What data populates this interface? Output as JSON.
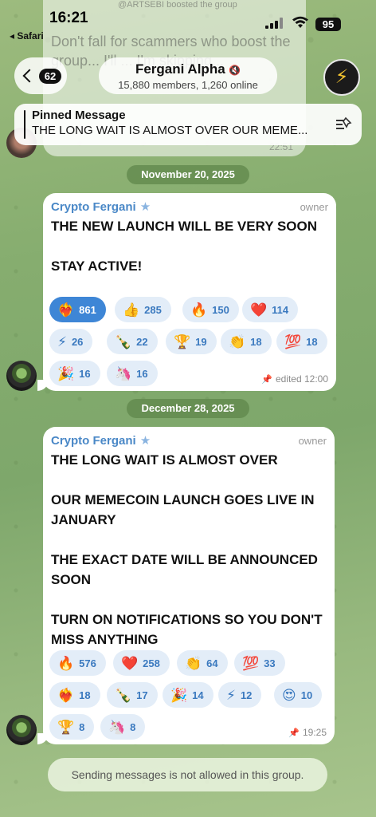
{
  "status_bar": {
    "time": "16:21",
    "back_app": "◂ Safari",
    "battery": "95"
  },
  "previous_message": {
    "top_text": "@ARTSEBI boosted the group",
    "text": "Don't fall for scammers who boost the group... I'll ... I'm skipping...",
    "time": "22:51"
  },
  "header": {
    "unread_count": "62",
    "title": "Fergani Alpha",
    "subtitle": "15,880 members, 1,260 online",
    "avatar_glyph": "⚡"
  },
  "pinned": {
    "label": "Pinned Message",
    "text": "THE LONG WAIT IS ALMOST OVER OUR MEME..."
  },
  "dates": [
    "November 20, 2025",
    "December 28, 2025"
  ],
  "messages": [
    {
      "sender": "Crypto Fergani",
      "role": "owner",
      "text": "THE NEW LAUNCH WILL BE VERY SOON\n\nSTAY ACTIVE!",
      "meta": "edited 12:00",
      "reactions": [
        {
          "emoji": "❤️‍🔥",
          "count": "861",
          "chosen": true
        },
        {
          "emoji": "👍",
          "count": "285"
        },
        {
          "emoji": "🔥",
          "count": "150"
        },
        {
          "emoji": "❤️",
          "count": "114"
        },
        {
          "emoji": "⚡",
          "count": "26"
        },
        {
          "emoji": "🍾",
          "count": "22"
        },
        {
          "emoji": "🏆",
          "count": "19"
        },
        {
          "emoji": "👏",
          "count": "18"
        },
        {
          "emoji": "💯",
          "count": "18"
        },
        {
          "emoji": "🎉",
          "count": "16"
        },
        {
          "emoji": "🦄",
          "count": "16"
        }
      ]
    },
    {
      "sender": "Crypto Fergani",
      "role": "owner",
      "text": "THE LONG WAIT IS ALMOST OVER\n\nOUR MEMECOIN LAUNCH GOES LIVE IN JANUARY\n\nTHE EXACT DATE WILL BE ANNOUNCED SOON\n\nTURN ON NOTIFICATIONS  SO YOU DON'T MISS ANYTHING",
      "meta": "19:25",
      "reactions": [
        {
          "emoji": "🔥",
          "count": "576"
        },
        {
          "emoji": "❤️",
          "count": "258"
        },
        {
          "emoji": "👏",
          "count": "64"
        },
        {
          "emoji": "💯",
          "count": "33"
        },
        {
          "emoji": "❤️‍🔥",
          "count": "18"
        },
        {
          "emoji": "🍾",
          "count": "17"
        },
        {
          "emoji": "🎉",
          "count": "14"
        },
        {
          "emoji": "⚡",
          "count": "12"
        },
        {
          "emoji": "😍",
          "count": "10"
        },
        {
          "emoji": "🏆",
          "count": "8"
        },
        {
          "emoji": "🦄",
          "count": "8"
        }
      ]
    }
  ],
  "footer": {
    "notice": "Sending messages is not allowed in this group."
  }
}
